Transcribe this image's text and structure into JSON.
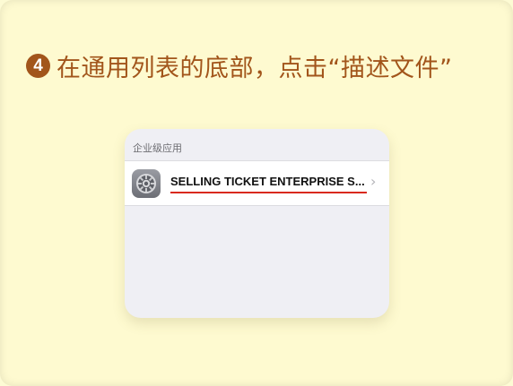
{
  "instruction": {
    "step_number": "4",
    "text": "在通用列表的底部，点击“描述文件”"
  },
  "panel": {
    "section_header": "企业级应用",
    "row": {
      "icon": "settings-gear-icon",
      "label": "SELLING TICKET ENTERPRISE S...",
      "chevron": "chevron-right-icon"
    }
  },
  "colors": {
    "accent": "#a2551b",
    "highlight_underline": "#d9291c",
    "background": "#fdfbd4"
  }
}
